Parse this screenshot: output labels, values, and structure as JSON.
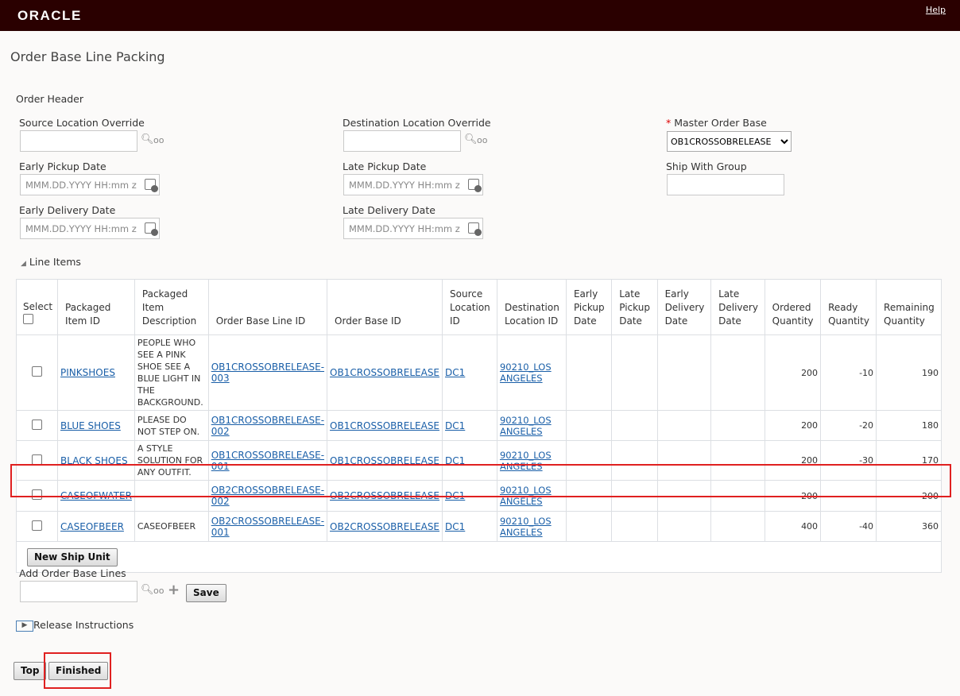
{
  "header": {
    "logo": "ORACLE",
    "help": "Help"
  },
  "page_title": "Order Base Line Packing",
  "order_header": {
    "title": "Order Header",
    "source_location_override": {
      "label": "Source Location Override",
      "value": ""
    },
    "destination_location_override": {
      "label": "Destination Location Override",
      "value": ""
    },
    "master_order_base": {
      "label": "Master Order Base",
      "required_mark": "*",
      "value": "OB1CROSSOBRELEASE"
    },
    "early_pickup_date": {
      "label": "Early Pickup Date",
      "placeholder": "MMM.DD.YYYY HH:mm z"
    },
    "late_pickup_date": {
      "label": "Late Pickup Date",
      "placeholder": "MMM.DD.YYYY HH:mm z"
    },
    "ship_with_group": {
      "label": "Ship With Group",
      "value": ""
    },
    "early_delivery_date": {
      "label": "Early Delivery Date",
      "placeholder": "MMM.DD.YYYY HH:mm z"
    },
    "late_delivery_date": {
      "label": "Late Delivery Date",
      "placeholder": "MMM.DD.YYYY HH:mm z"
    }
  },
  "line_items": {
    "title": "Line Items",
    "columns": [
      "Select",
      "Packaged Item ID",
      "Packaged Item Description",
      "Order Base Line ID",
      "Order Base ID",
      "Source Location ID",
      "Destination Location ID",
      "Early Pickup Date",
      "Late Pickup Date",
      "Early Delivery Date",
      "Late Delivery Date",
      "Ordered Quantity",
      "Ready Quantity",
      "Remaining Quantity"
    ],
    "rows": [
      {
        "item": "PINKSHOES",
        "desc": "PEOPLE WHO SEE A PINK SHOE SEE A BLUE LIGHT IN THE BACKGROUND.",
        "line": "OB1CROSSOBRELEASE-003",
        "ob": "OB1CROSSOBRELEASE",
        "src": "DC1",
        "dest": "90210_LOS ANGELES",
        "ordered": "200",
        "ready": "-10",
        "remaining": "190"
      },
      {
        "item": "BLUE SHOES",
        "desc": "PLEASE DO NOT STEP ON.",
        "line": "OB1CROSSOBRELEASE-002",
        "ob": "OB1CROSSOBRELEASE",
        "src": "DC1",
        "dest": "90210_LOS ANGELES",
        "ordered": "200",
        "ready": "-20",
        "remaining": "180"
      },
      {
        "item": "BLACK SHOES",
        "desc": "A STYLE SOLUTION FOR ANY OUTFIT.",
        "line": "OB1CROSSOBRELEASE-001",
        "ob": "OB1CROSSOBRELEASE",
        "src": "DC1",
        "dest": "90210_LOS ANGELES",
        "ordered": "200",
        "ready": "-30",
        "remaining": "170"
      },
      {
        "item": "CASEOFWATER",
        "desc": "",
        "line": "OB2CROSSOBRELEASE-002",
        "ob": "OB2CROSSOBRELEASE",
        "src": "DC1",
        "dest": "90210_LOS ANGELES",
        "ordered": "200",
        "ready": "",
        "remaining": "200"
      },
      {
        "item": "CASEOFBEER",
        "desc": "CASEOFBEER",
        "line": "OB2CROSSOBRELEASE-001",
        "ob": "OB2CROSSOBRELEASE",
        "src": "DC1",
        "dest": "90210_LOS ANGELES",
        "ordered": "400",
        "ready": "-40",
        "remaining": "360"
      }
    ],
    "new_ship_unit": "New Ship Unit"
  },
  "add_order_base_lines": {
    "label": "Add Order Base Lines",
    "value": "",
    "save": "Save"
  },
  "release_instructions": "Release Instructions",
  "footer": {
    "top": "Top",
    "finished": "Finished"
  },
  "colors": {
    "header_bg": "#2a0000",
    "link": "#1a5fa8",
    "highlight": "#e02020"
  }
}
